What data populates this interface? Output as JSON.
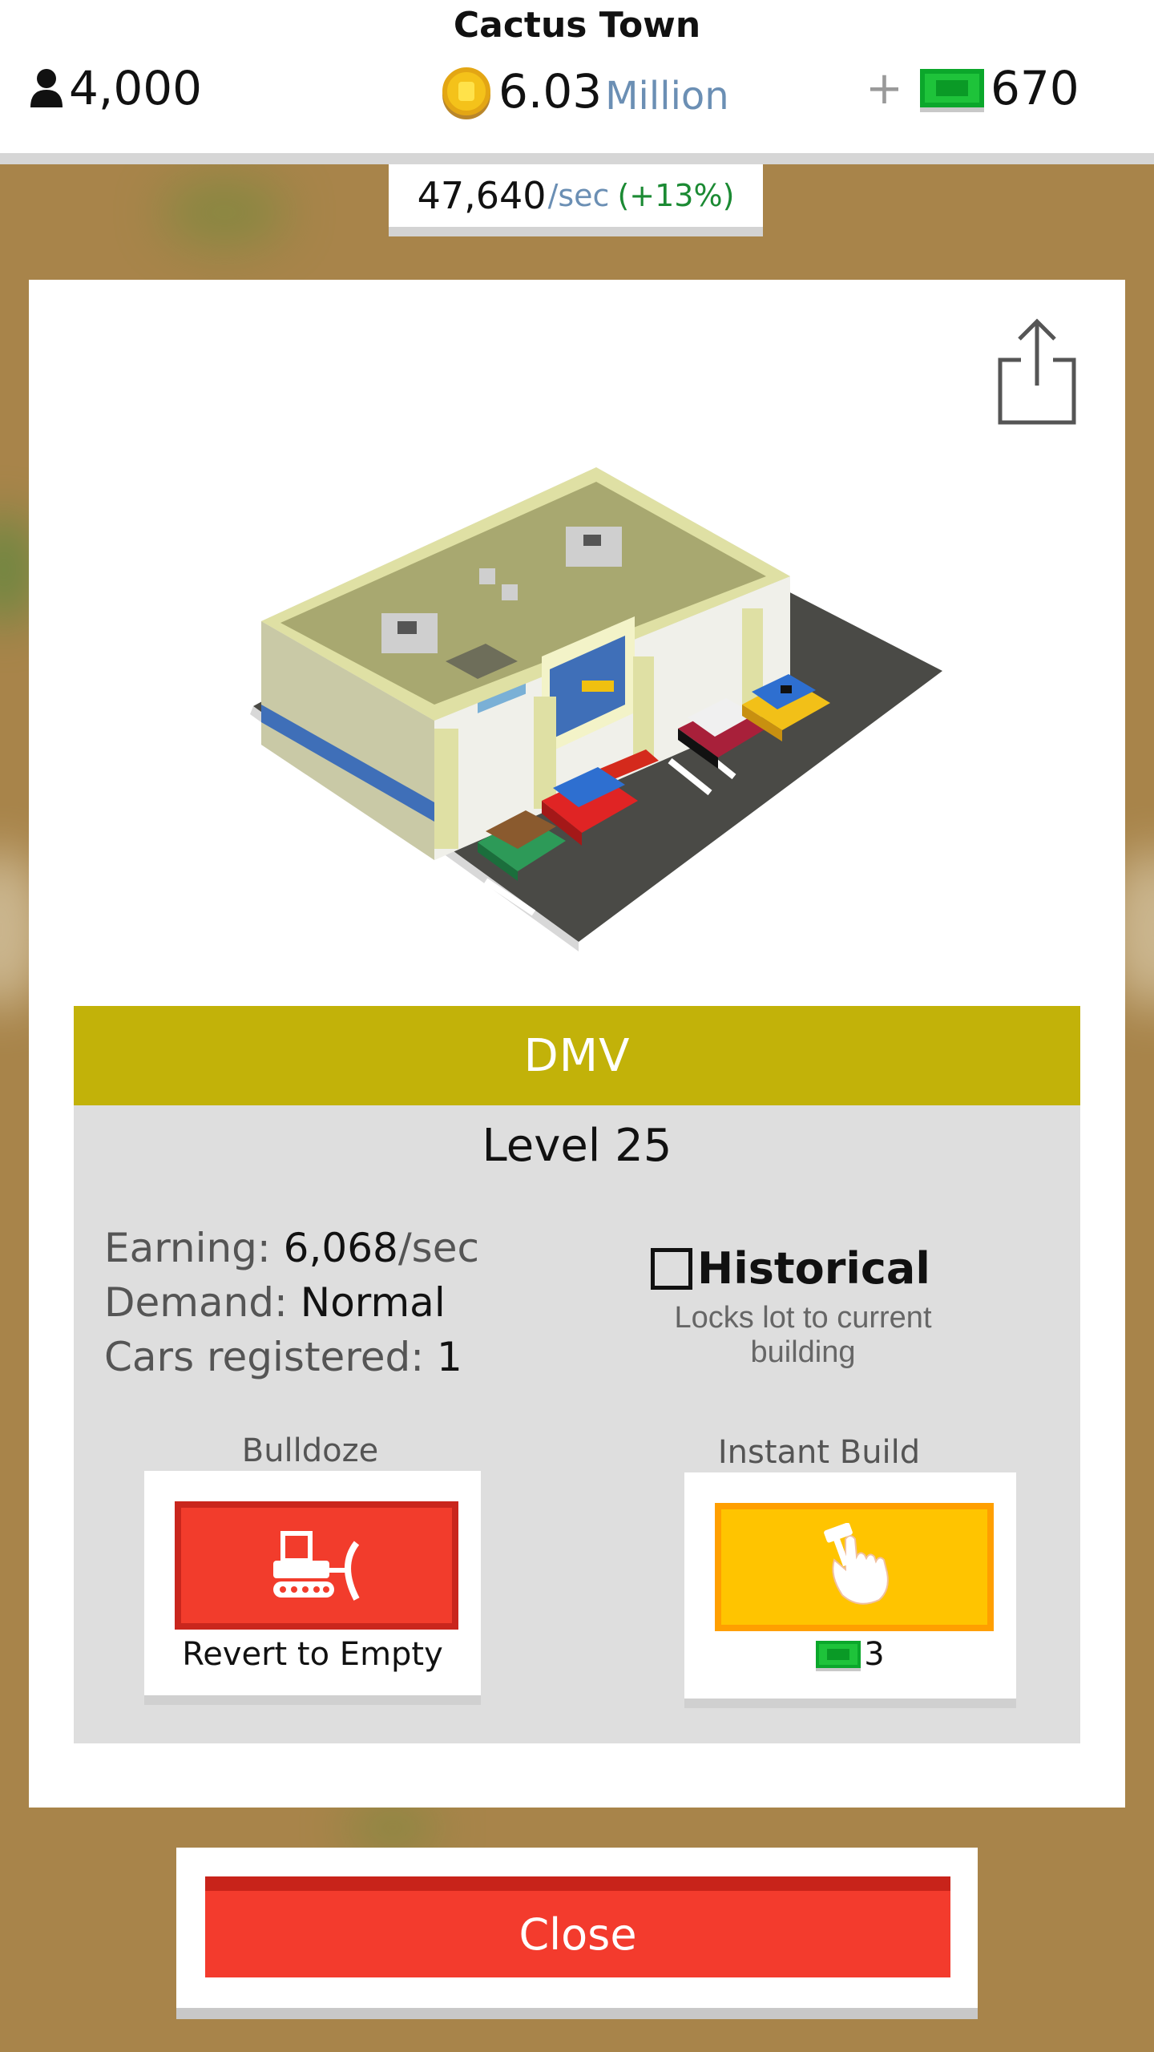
{
  "hud": {
    "town_name": "Cactus Town",
    "population": "4,000",
    "coins_value": "6.03",
    "coins_unit": "Million",
    "plus_label": "+",
    "cash": "670",
    "rate_value": "47,640",
    "rate_unit": "/sec",
    "rate_bonus": "(+13%)"
  },
  "building": {
    "name": "DMV",
    "level": "Level 25",
    "earning_label": "Earning:",
    "earning_value": "6,068",
    "earning_unit": "/sec",
    "demand_label": "Demand:",
    "demand_value": "Normal",
    "cars_label": "Cars registered:",
    "cars_value": "1"
  },
  "historical": {
    "label": "Historical",
    "checked": false,
    "description": "Locks lot to current building"
  },
  "actions": {
    "bulldoze_title": "Bulldoze",
    "bulldoze_caption": "Revert to Empty",
    "instant_title": "Instant Build",
    "instant_cost": "3"
  },
  "close_label": "Close",
  "colors": {
    "name_bar": "#c2b209",
    "danger": "#f23c2c",
    "gold": "#ffc400",
    "cash_green": "#1ec33a",
    "rate_unit": "#6b8fb4",
    "rate_bonus": "#1b8a33"
  }
}
